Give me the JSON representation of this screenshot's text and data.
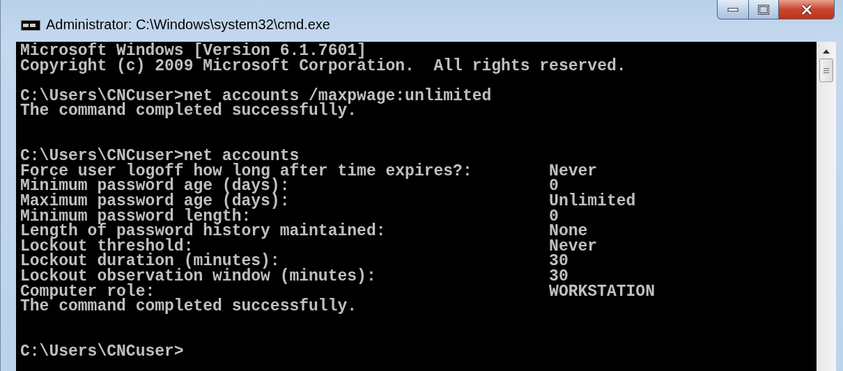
{
  "window": {
    "title": "Administrator: C:\\Windows\\system32\\cmd.exe"
  },
  "console": {
    "lines": [
      {
        "kind": "text",
        "text": "Microsoft Windows [Version 6.1.7601]"
      },
      {
        "kind": "text",
        "text": "Copyright (c) 2009 Microsoft Corporation.  All rights reserved."
      },
      {
        "kind": "blank"
      },
      {
        "kind": "text",
        "text": "C:\\Users\\CNCuser>net accounts /maxpwage:unlimited"
      },
      {
        "kind": "text",
        "text": "The command completed successfully."
      },
      {
        "kind": "blank"
      },
      {
        "kind": "blank"
      },
      {
        "kind": "text",
        "text": "C:\\Users\\CNCuser>net accounts"
      },
      {
        "kind": "setting",
        "text": "Force user logoff how long after time expires?:",
        "value": "Never"
      },
      {
        "kind": "setting",
        "text": "Minimum password age (days):",
        "value": "0"
      },
      {
        "kind": "setting",
        "text": "Maximum password age (days):",
        "value": "Unlimited"
      },
      {
        "kind": "setting",
        "text": "Minimum password length:",
        "value": "0"
      },
      {
        "kind": "setting",
        "text": "Length of password history maintained:",
        "value": "None"
      },
      {
        "kind": "setting",
        "text": "Lockout threshold:",
        "value": "Never"
      },
      {
        "kind": "setting",
        "text": "Lockout duration (minutes):",
        "value": "30"
      },
      {
        "kind": "setting",
        "text": "Lockout observation window (minutes):",
        "value": "30"
      },
      {
        "kind": "setting",
        "text": "Computer role:",
        "value": "WORKSTATION"
      },
      {
        "kind": "text",
        "text": "The command completed successfully."
      },
      {
        "kind": "blank"
      },
      {
        "kind": "blank"
      },
      {
        "kind": "text",
        "text": "C:\\Users\\CNCuser>"
      }
    ]
  }
}
